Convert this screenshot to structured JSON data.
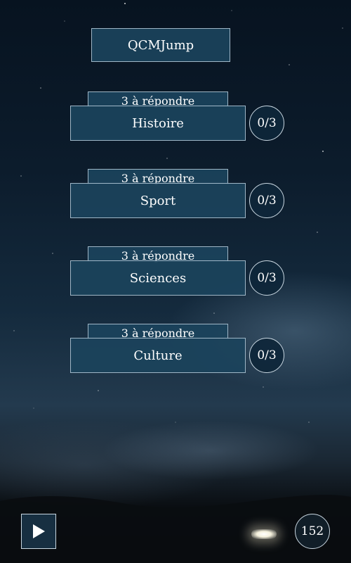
{
  "app": {
    "title": "QCMJump"
  },
  "quizzes": [
    {
      "tag": "3 à répondre",
      "label": "Histoire",
      "score": "0/3"
    },
    {
      "tag": "3 à répondre",
      "label": "Sport",
      "score": "0/3"
    },
    {
      "tag": "3 à répondre",
      "label": "Sciences",
      "score": "0/3"
    },
    {
      "tag": "3 à répondre",
      "label": "Culture",
      "score": "0/3"
    }
  ],
  "footer": {
    "play_icon": "play-icon",
    "counter": "152"
  },
  "colors": {
    "panel": "#1b435c",
    "border": "#9fb6c6",
    "text": "#ffffff"
  }
}
